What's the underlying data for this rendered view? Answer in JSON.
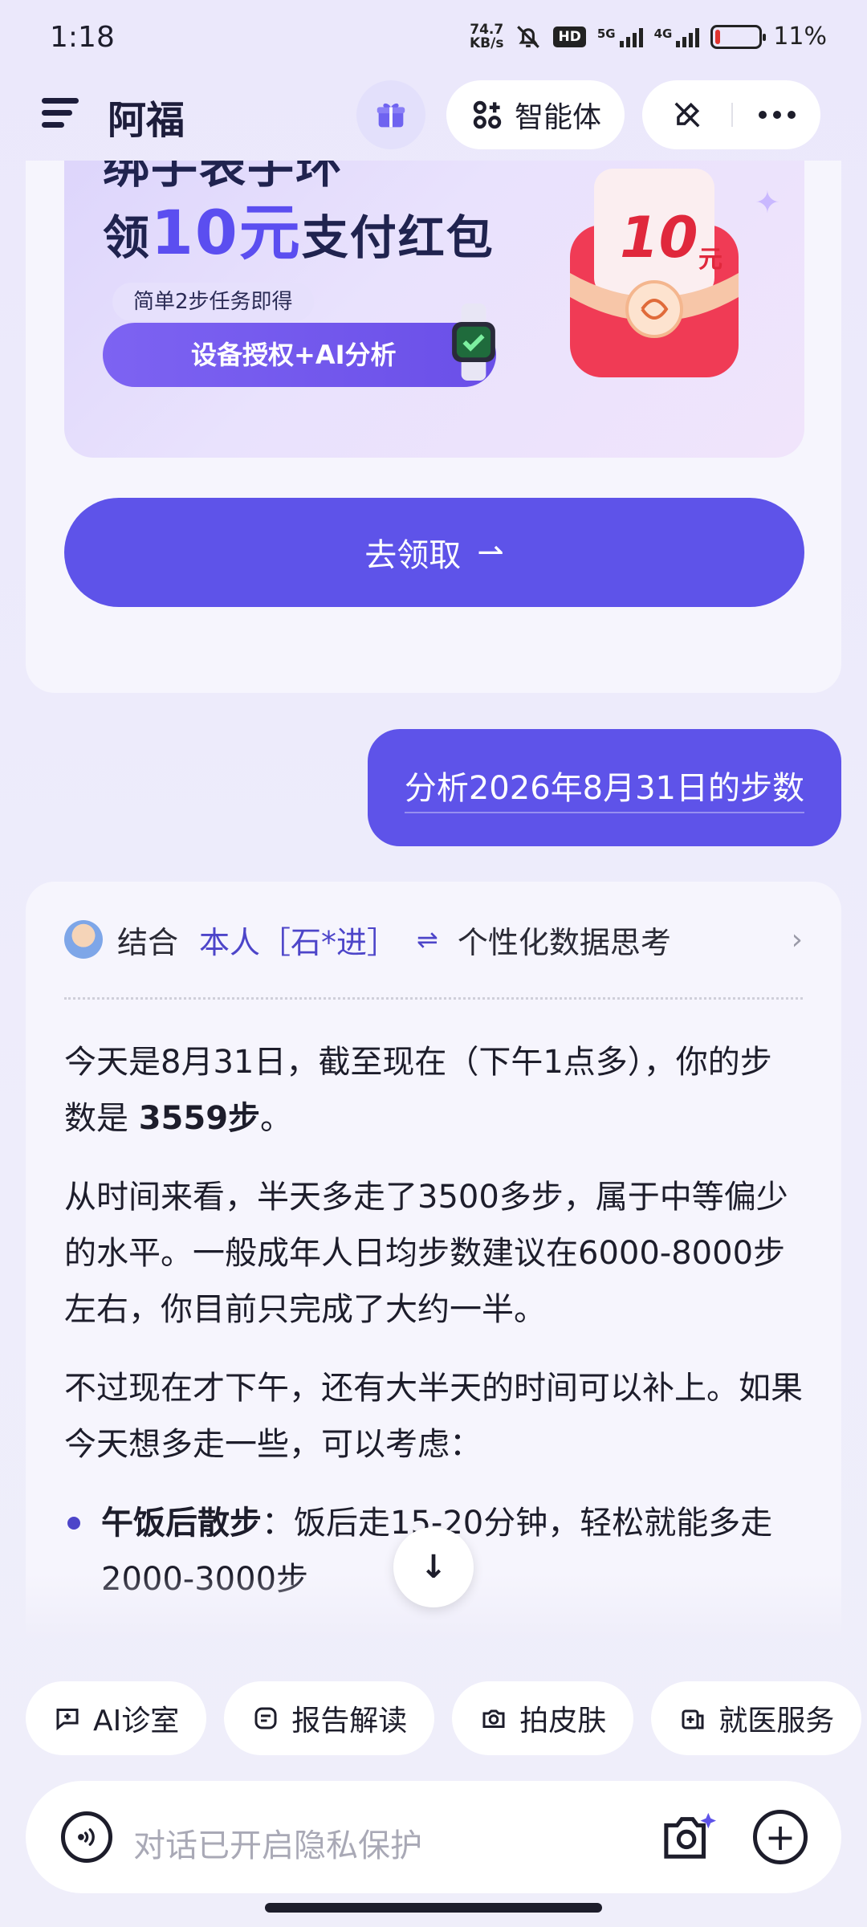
{
  "status_bar": {
    "time": "1:18",
    "net_speed_value": "74.7",
    "net_speed_unit": "KB/s",
    "hd_badge": "HD",
    "signal1_label": "5G",
    "signal2_label": "4G",
    "battery_percent": "11%",
    "battery_level": 0.11
  },
  "header": {
    "title": "阿福",
    "agent_label": "智能体",
    "icons": {
      "menu": "menu-icon",
      "gift": "gift-icon",
      "agent": "agent-grid-icon",
      "pen": "pen-off-icon",
      "more": "more-icon"
    }
  },
  "promo": {
    "banner_line1": "绑手表手环",
    "banner_line2_pre": "领",
    "banner_line2_amount": "10元",
    "banner_line2_post": "支付红包",
    "banner_tag": "简单2步任务即得",
    "banner_cta": "设备授权+AI分析",
    "packet_amount": "10",
    "packet_unit": "元",
    "claim_label": "去领取",
    "claim_arrow": "⇀"
  },
  "conversation": {
    "user_message": "分析2026年8月31日的步数",
    "think_prefix": "结合",
    "think_person": "本人［石*进］",
    "think_link_symbol": "⇌",
    "think_suffix": "个性化数据思考",
    "para1_text": "今天是8月31日，截至现在（下午1点多），你的步数是",
    "para1_bold": "3559步",
    "para1_end": "。",
    "para2": "从时间来看，半天多走了3500多步，属于中等偏少的水平。一般成年人日均步数建议在6000-8000步左右，你目前只完成了大约一半。",
    "para3": "不过现在才下午，还有大半天的时间可以补上。如果今天想多走一些，可以考虑：",
    "bullet1_bold": "午饭后散步",
    "bullet1_text": "：饭后走15-20分钟，轻松就能多走2000-3000步"
  },
  "chips": [
    {
      "label": "AI诊室",
      "icon": "chat-plus-icon"
    },
    {
      "label": "报告解读",
      "icon": "report-icon"
    },
    {
      "label": "拍皮肤",
      "icon": "camera-icon"
    },
    {
      "label": "就医服务",
      "icon": "hospital-icon"
    }
  ],
  "input": {
    "placeholder": "对话已开启隐私保护"
  },
  "colors": {
    "accent": "#5e53e9",
    "background": "#ecebfb",
    "card": "#f6f5fd"
  }
}
